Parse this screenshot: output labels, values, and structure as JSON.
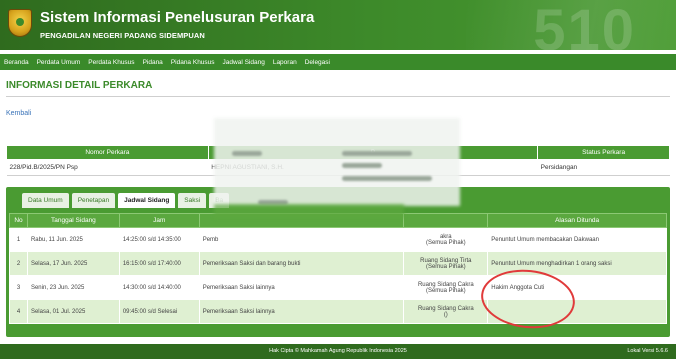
{
  "header": {
    "title": "Sistem Informasi Penelusuran Perkara",
    "subtitle": "PENGADILAN NEGERI PADANG SIDEMPUAN",
    "watermark": "510"
  },
  "nav": [
    "Beranda",
    "Perdata Umum",
    "Perdata Khusus",
    "Pidana",
    "Pidana Khusus",
    "Jadwal Sidang",
    "Laporan",
    "Delegasi"
  ],
  "page": {
    "section_title": "INFORMASI DETAIL PERKARA",
    "back_link": "Kembali"
  },
  "case": {
    "headers": [
      "Nomor Perkara",
      "P",
      "Status Perkara"
    ],
    "row": {
      "nomor": "228/Pid.B/2025/PN Psp",
      "pihak": "HEPNI AGUSTIANI, S.H.",
      "status": "Persidangan"
    }
  },
  "tabs": [
    "Data Umum",
    "Penetapan",
    "Jadwal Sidang",
    "Saksi",
    "Ba"
  ],
  "active_tab": "Jadwal Sidang",
  "schedule": {
    "headers": [
      "No",
      "Tanggal Sidang",
      "Jam",
      "",
      "",
      "Alasan Ditunda"
    ],
    "rows": [
      {
        "no": "1",
        "tanggal": "Rabu, 11 Jun. 2025",
        "jam": "14:25:00 s/d 14:35:00",
        "agenda": "Pemb",
        "ruang": "akra\n(Semua Pihak)",
        "alasan": "Penuntut Umum membacakan Dakwaan"
      },
      {
        "no": "2",
        "tanggal": "Selasa, 17 Jun. 2025",
        "jam": "16:15:00 s/d 17:40:00",
        "agenda": "Pemeriksaan Saksi dan barang bukti",
        "ruang": "Ruang Sidang Tirta\n(Semua Pihak)",
        "alasan": "Penuntut Umum menghadirkan 1 orang saksi"
      },
      {
        "no": "3",
        "tanggal": "Senin, 23 Jun. 2025",
        "jam": "14:30:00 s/d 14:40:00",
        "agenda": "Pemeriksaan Saksi lainnya",
        "ruang": "Ruang Sidang Cakra\n(Semua Pihak)",
        "alasan": "Hakim Anggota Cuti"
      },
      {
        "no": "4",
        "tanggal": "Selasa, 01 Jul. 2025",
        "jam": "09:45:00 s/d Selesai",
        "agenda": "Pemeriksaan Saksi lainnya",
        "ruang": "Ruang Sidang Cakra\n()",
        "alasan": ""
      }
    ]
  },
  "footer": {
    "copyright": "Hak Cipta © Mahkamah Agung Republik Indonesia 2025",
    "version": "Lokal Versi 5.6.6"
  },
  "colors": {
    "header": "#3d8a2a",
    "nav": "#3a8a2a",
    "accent": "#4a9b32",
    "annotation": "#e03a3a"
  }
}
